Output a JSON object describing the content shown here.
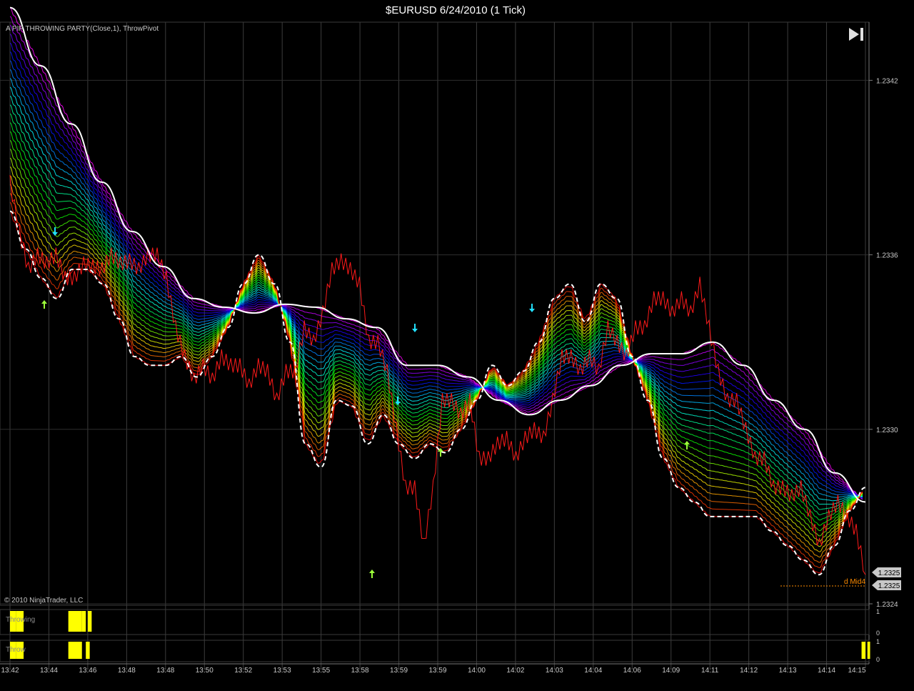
{
  "window": {
    "title": "$EURUSD  6/24/2010 (1 Tick)"
  },
  "indicator_label": "A PIP THROWING PARTY(Close,1), ThrowPivot",
  "copyright": "© 2010 NinjaTrader, LLC",
  "scroll_end_icon": "skip-to-end-icon",
  "colors": {
    "background": "#000000",
    "price": "#ff1a1a",
    "envelope": "#ffffff",
    "pivot": "#ffffff",
    "up_arrow": "#9dff3a",
    "down_arrow": "#22e0ff",
    "panel_fill": "#ffff00",
    "axis_text": "#c8c8c8",
    "marker_text": "#ff8c00"
  },
  "chart_data": {
    "type": "line",
    "title": "$EURUSD  6/24/2010 (1 Tick)",
    "xlabel": "",
    "ylabel": "",
    "ylim": [
      1.2324,
      1.2344
    ],
    "y_ticks": [
      "1.2342",
      "1.2336",
      "1.2330",
      "1.2324"
    ],
    "x_ticks": [
      "13:42",
      "13:44",
      "13:46",
      "13:48",
      "13:48",
      "13:50",
      "13:52",
      "13:53",
      "13:55",
      "13:58",
      "13:59",
      "13:59",
      "14:00",
      "14:02",
      "14:03",
      "14:04",
      "14:06",
      "14:09",
      "14:11",
      "14:12",
      "14:13",
      "14:14",
      "14:15"
    ],
    "grid": true,
    "price_labels": [
      "1.2325",
      "1.2325"
    ],
    "marker_label": "d Mid4",
    "series": [
      {
        "values": [
          1.23385,
          1.23368,
          1.23355,
          1.2336,
          1.23357,
          1.2336,
          1.23352,
          1.23352,
          1.23357,
          1.23356,
          1.23355,
          1.2336,
          1.23357,
          1.23358,
          1.23355,
          1.2336,
          1.2336,
          1.23352,
          1.23335,
          1.23325,
          1.23317,
          1.23322,
          1.23317,
          1.23325,
          1.23322,
          1.23322,
          1.23315,
          1.23322,
          1.2332,
          1.2331,
          1.2332,
          1.2332,
          1.23335,
          1.2333,
          1.2334,
          1.23355,
          1.23358,
          1.23355,
          1.2335,
          1.2333,
          1.2333,
          1.2332,
          1.233,
          1.2328,
          1.2328,
          1.2326,
          1.2328,
          1.2331,
          1.2331,
          1.23305,
          1.2331,
          1.2329,
          1.2329,
          1.23295,
          1.23297,
          1.2329,
          1.23297,
          1.233,
          1.23297,
          1.2331,
          1.23325,
          1.23325,
          1.2332,
          1.23325,
          1.2332,
          1.23335,
          1.2333,
          1.23325,
          1.23335,
          1.23335,
          1.23345,
          1.23345,
          1.2334,
          1.23345,
          1.2334,
          1.2335,
          1.23335,
          1.2332,
          1.2331,
          1.2331,
          1.233,
          1.2329,
          1.2329,
          1.2328,
          1.2328,
          1.23277,
          1.2328,
          1.2327,
          1.2326,
          1.2327,
          1.23275,
          1.2327,
          1.23265,
          1.2325
        ]
      },
      {
        "values": [
          1.23375,
          1.23362,
          1.23352,
          1.23345,
          1.23355,
          1.23355,
          1.2335,
          1.23338,
          1.23325,
          1.23322,
          1.23322,
          1.23325,
          1.23318,
          1.23325,
          1.23335,
          1.2335,
          1.2336,
          1.2335,
          1.2333,
          1.23295,
          1.23287,
          1.2331,
          1.23308,
          1.23295,
          1.23305,
          1.23295,
          1.2329,
          1.23295,
          1.23292,
          1.233,
          1.2331,
          1.23322,
          1.23315,
          1.2332,
          1.2333,
          1.23345,
          1.2335,
          1.23337,
          1.2335,
          1.23345,
          1.23325,
          1.2331,
          1.2329,
          1.2328,
          1.23275,
          1.2327,
          1.2327,
          1.2327,
          1.2327,
          1.23265,
          1.2326,
          1.23255,
          1.2325,
          1.2326,
          1.23272,
          1.2328
        ]
      },
      {
        "values": [
          1.23445,
          1.23425,
          1.23405,
          1.23385,
          1.23368,
          1.23356,
          1.23345,
          1.23342,
          1.2334,
          1.23343,
          1.23342,
          1.23338,
          1.23335,
          1.23322,
          1.23322,
          1.23318,
          1.2331,
          1.23305,
          1.2331,
          1.23315,
          1.23322,
          1.23326,
          1.23326,
          1.2333,
          1.23322,
          1.2331,
          1.233,
          1.23285,
          1.23275
        ]
      }
    ],
    "up_arrows": 6,
    "down_arrows": 4
  },
  "panels": [
    {
      "label": "Throwing",
      "top_value": "1",
      "bottom_value": "0",
      "segments": [
        [
          0.0,
          0.15
        ],
        [
          0.15,
          0.35
        ],
        [
          1.5,
          1.85
        ],
        [
          1.85,
          1.95
        ],
        [
          2.0,
          2.1
        ]
      ]
    },
    {
      "label": "Throw",
      "top_value": "1",
      "bottom_value": "0",
      "segments": [
        [
          0.0,
          0.15
        ],
        [
          0.15,
          0.35
        ],
        [
          1.5,
          1.85
        ],
        [
          1.95,
          2.05
        ],
        [
          21.9,
          22.0
        ],
        [
          22.05,
          22.12
        ]
      ]
    }
  ]
}
